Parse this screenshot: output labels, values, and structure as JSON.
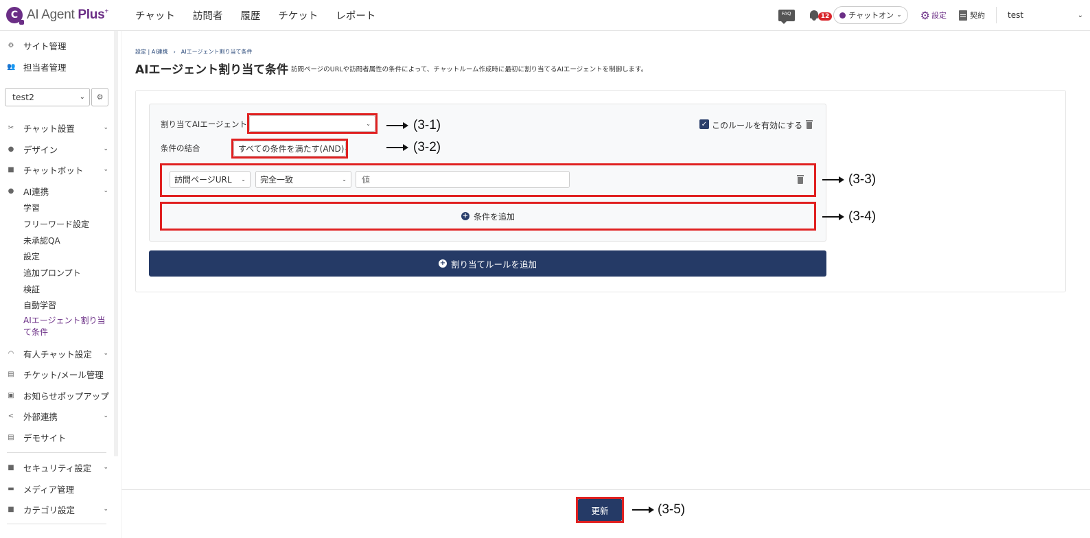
{
  "app": {
    "logo_mark": "C",
    "logo_text": "AI Agent ",
    "logo_plus": "Plus",
    "logo_sup": "+"
  },
  "nav": [
    "チャット",
    "訪問者",
    "履歴",
    "チケット",
    "レポート"
  ],
  "header": {
    "faq_label": "FAQ",
    "notification_count": "12",
    "chat_status": "チャットオン",
    "settings_label": "設定",
    "contract_label": "契約",
    "user": "test"
  },
  "sidebar": {
    "site_admin": "サイト管理",
    "staff_admin": "担当者管理",
    "site_select": "test2",
    "menu": [
      {
        "label": "チャット設置"
      },
      {
        "label": "デザイン"
      },
      {
        "label": "チャットボット"
      },
      {
        "label": "AI連携"
      },
      {
        "label": "有人チャット設定"
      },
      {
        "label": "チケット/メール管理"
      },
      {
        "label": "お知らせポップアップ"
      },
      {
        "label": "外部連携"
      },
      {
        "label": "デモサイト"
      },
      {
        "label": "セキュリティ設定"
      },
      {
        "label": "メディア管理"
      },
      {
        "label": "カテゴリ設定"
      }
    ],
    "ai_sub": [
      "学習",
      "フリーワード設定",
      "未承認QA",
      "設定",
      "追加プロンプト",
      "検証",
      "自動学習",
      "AIエージェント割り当て条件"
    ]
  },
  "page": {
    "breadcrumb": "設定 | AI連携　›　AIエージェント割り当て条件",
    "title": "AIエージェント割り当て条件",
    "description": "訪問ページのURLや訪問者属性の条件によって、チャットルーム作成時に最初に割り当てるAIエージェントを制御します。"
  },
  "rule": {
    "agent_label": "割り当てAIエージェント",
    "agent_value": "",
    "combine_label": "条件の結合",
    "combine_value": "すべての条件を満たす(AND)",
    "enable_label": "このルールを有効にする",
    "enabled": true,
    "condition": {
      "field": "訪問ページURL",
      "operator": "完全一致",
      "value_placeholder": "値"
    },
    "add_condition_label": "条件を追加"
  },
  "add_rule_label": "割り当てルールを追加",
  "update_label": "更新",
  "annotations": [
    "(3-1)",
    "(3-2)",
    "(3-3)",
    "(3-4)",
    "(3-5)"
  ],
  "colors": {
    "brand": "#6b2e86",
    "navy": "#253a66",
    "annotation_red": "#e02020",
    "badge": "#d9262c"
  }
}
